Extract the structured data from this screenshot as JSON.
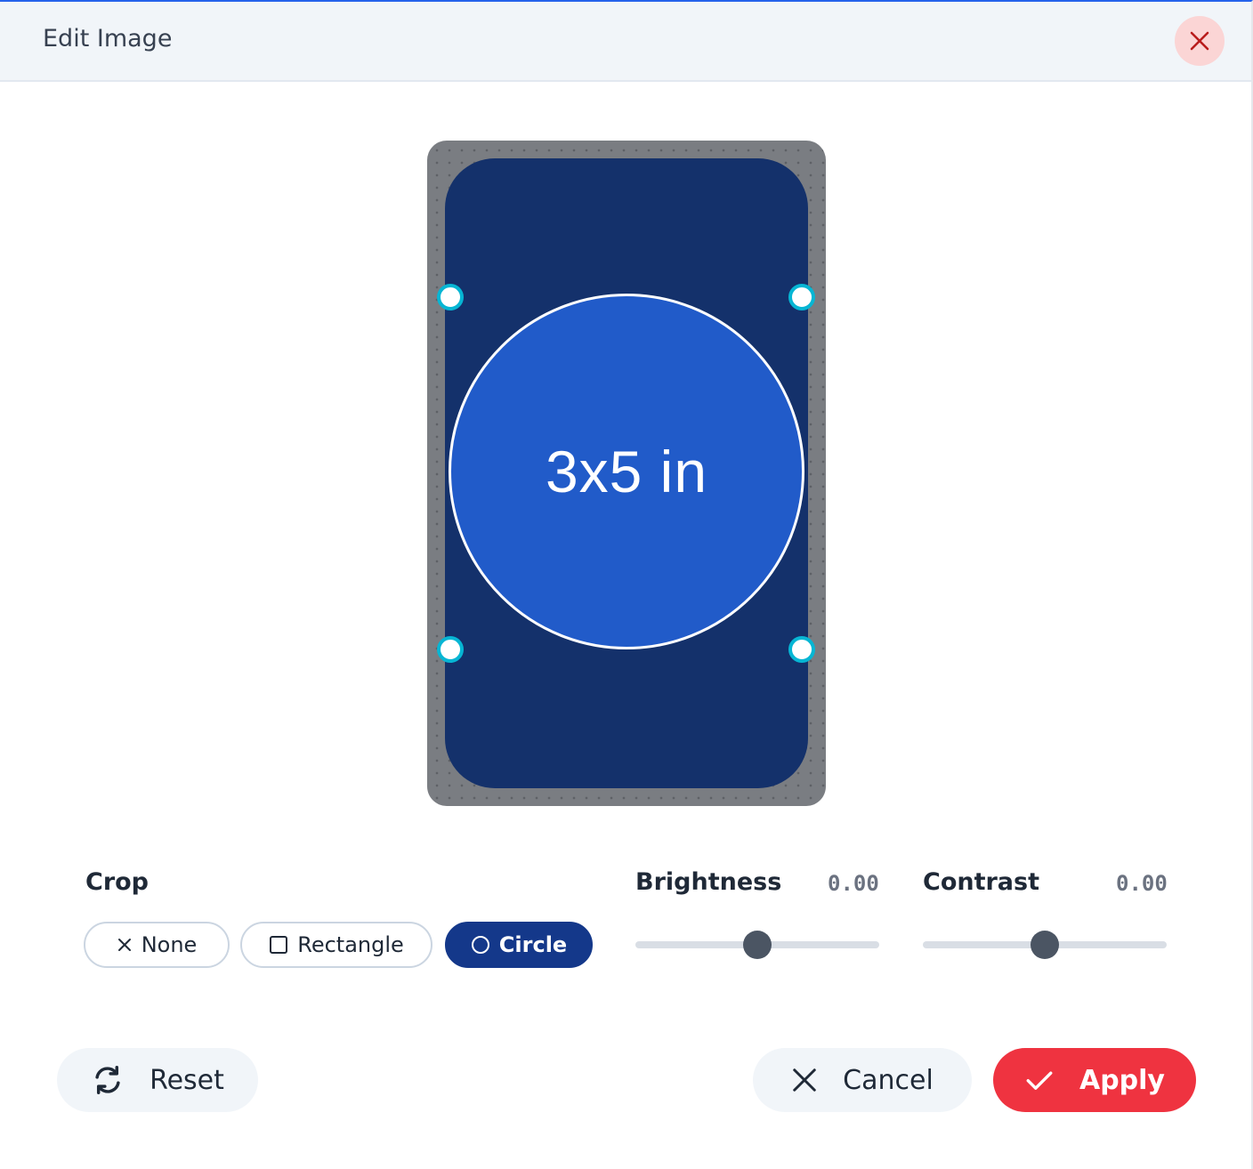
{
  "dialog": {
    "title": "Edit Image",
    "close_icon": "close-icon"
  },
  "preview": {
    "size_label": "3x5 in",
    "crop_shape": "circle"
  },
  "crop": {
    "label": "Crop",
    "options": [
      {
        "label": "None",
        "icon": "x-icon",
        "selected": false
      },
      {
        "label": "Rectangle",
        "icon": "square-icon",
        "selected": false
      },
      {
        "label": "Circle",
        "icon": "circle-icon",
        "selected": true
      }
    ]
  },
  "brightness": {
    "label": "Brightness",
    "value_text": "0.00",
    "value": 0.0,
    "min": -1,
    "max": 1
  },
  "contrast": {
    "label": "Contrast",
    "value_text": "0.00",
    "value": 0.0,
    "min": -1,
    "max": 1
  },
  "actions": {
    "reset_label": "Reset",
    "cancel_label": "Cancel",
    "apply_label": "Apply"
  },
  "colors": {
    "accent": "#2563eb",
    "selected_chip": "#14388a",
    "apply": "#ef3340",
    "card": "#14316b",
    "crop_fill": "#215bc9",
    "handle": "#06b6d4"
  }
}
